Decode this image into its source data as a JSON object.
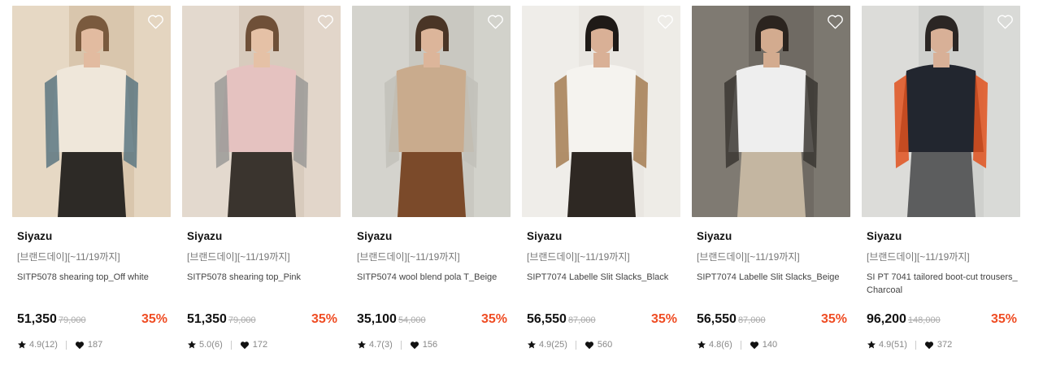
{
  "products": [
    {
      "brand": "Siyazu",
      "promo": "[브랜드데이][~11/19까지]",
      "name": "SITP5078 shearing top_Off white",
      "price": "51,350",
      "original_price": "79,000",
      "discount": "35%",
      "rating": "4.9(12)",
      "likes": "187",
      "palette": {
        "bg": "#d9c6ad",
        "bg2": "#efe4d4",
        "skin": "#e2bba0",
        "hair": "#7a5a3e",
        "top": "#efe7da",
        "bottom": "#2d2a26",
        "accent": "#5c7781"
      }
    },
    {
      "brand": "Siyazu",
      "promo": "[브랜드데이][~11/19까지]",
      "name": "SITP5078 shearing top_Pink",
      "price": "51,350",
      "original_price": "79,000",
      "discount": "35%",
      "rating": "5.0(6)",
      "likes": "172",
      "palette": {
        "bg": "#d8cbbd",
        "bg2": "#ebe2d8",
        "skin": "#e5c1a6",
        "hair": "#6f5038",
        "top": "#e5c2c0",
        "bottom": "#3a342e",
        "accent": "#9b9a98"
      }
    },
    {
      "brand": "Siyazu",
      "promo": "[브랜드데이][~11/19까지]",
      "name": "SITP5074 wool blend pola T_Beige",
      "price": "35,100",
      "original_price": "54,000",
      "discount": "35%",
      "rating": "4.7(3)",
      "likes": "156",
      "palette": {
        "bg": "#c9c8c1",
        "bg2": "#dcdbd5",
        "skin": "#dcb59a",
        "hair": "#4a3526",
        "top": "#c9ab8d",
        "bottom": "#7b4a2a",
        "accent": "#c2c1ba"
      }
    },
    {
      "brand": "Siyazu",
      "promo": "[브랜드데이][~11/19까지]",
      "name": "SIPT7074 Labelle Slit Slacks_Black",
      "price": "56,550",
      "original_price": "87,000",
      "discount": "35%",
      "rating": "4.9(25)",
      "likes": "560",
      "palette": {
        "bg": "#e9e6e1",
        "bg2": "#f4f2ee",
        "skin": "#d9b096",
        "hair": "#1f1a17",
        "top": "#f5f3ef",
        "bottom": "#2e2823",
        "accent": "#a57c52"
      }
    },
    {
      "brand": "Siyazu",
      "promo": "[브랜드데이][~11/19까지]",
      "name": "SIPT7074 Labelle Slit Slacks_Beige",
      "price": "56,550",
      "original_price": "87,000",
      "discount": "35%",
      "rating": "4.8(6)",
      "likes": "140",
      "palette": {
        "bg": "#6f6a63",
        "bg2": "#8a857d",
        "skin": "#d3ab8f",
        "hair": "#2b241f",
        "top": "#eeeeee",
        "bottom": "#c4b6a1",
        "accent": "#3b3733"
      }
    },
    {
      "brand": "Siyazu",
      "promo": "[브랜드데이][~11/19까지]",
      "name": "SI PT 7041 tailored boot-cut trousers_Charcoal",
      "price": "96,200",
      "original_price": "148,000",
      "discount": "35%",
      "rating": "4.9(51)",
      "likes": "372",
      "palette": {
        "bg": "#cfd0cd",
        "bg2": "#e4e4e1",
        "skin": "#d8b097",
        "hair": "#2b2624",
        "top": "#22262f",
        "bottom": "#5c5d5e",
        "accent": "#e0521f"
      }
    }
  ]
}
